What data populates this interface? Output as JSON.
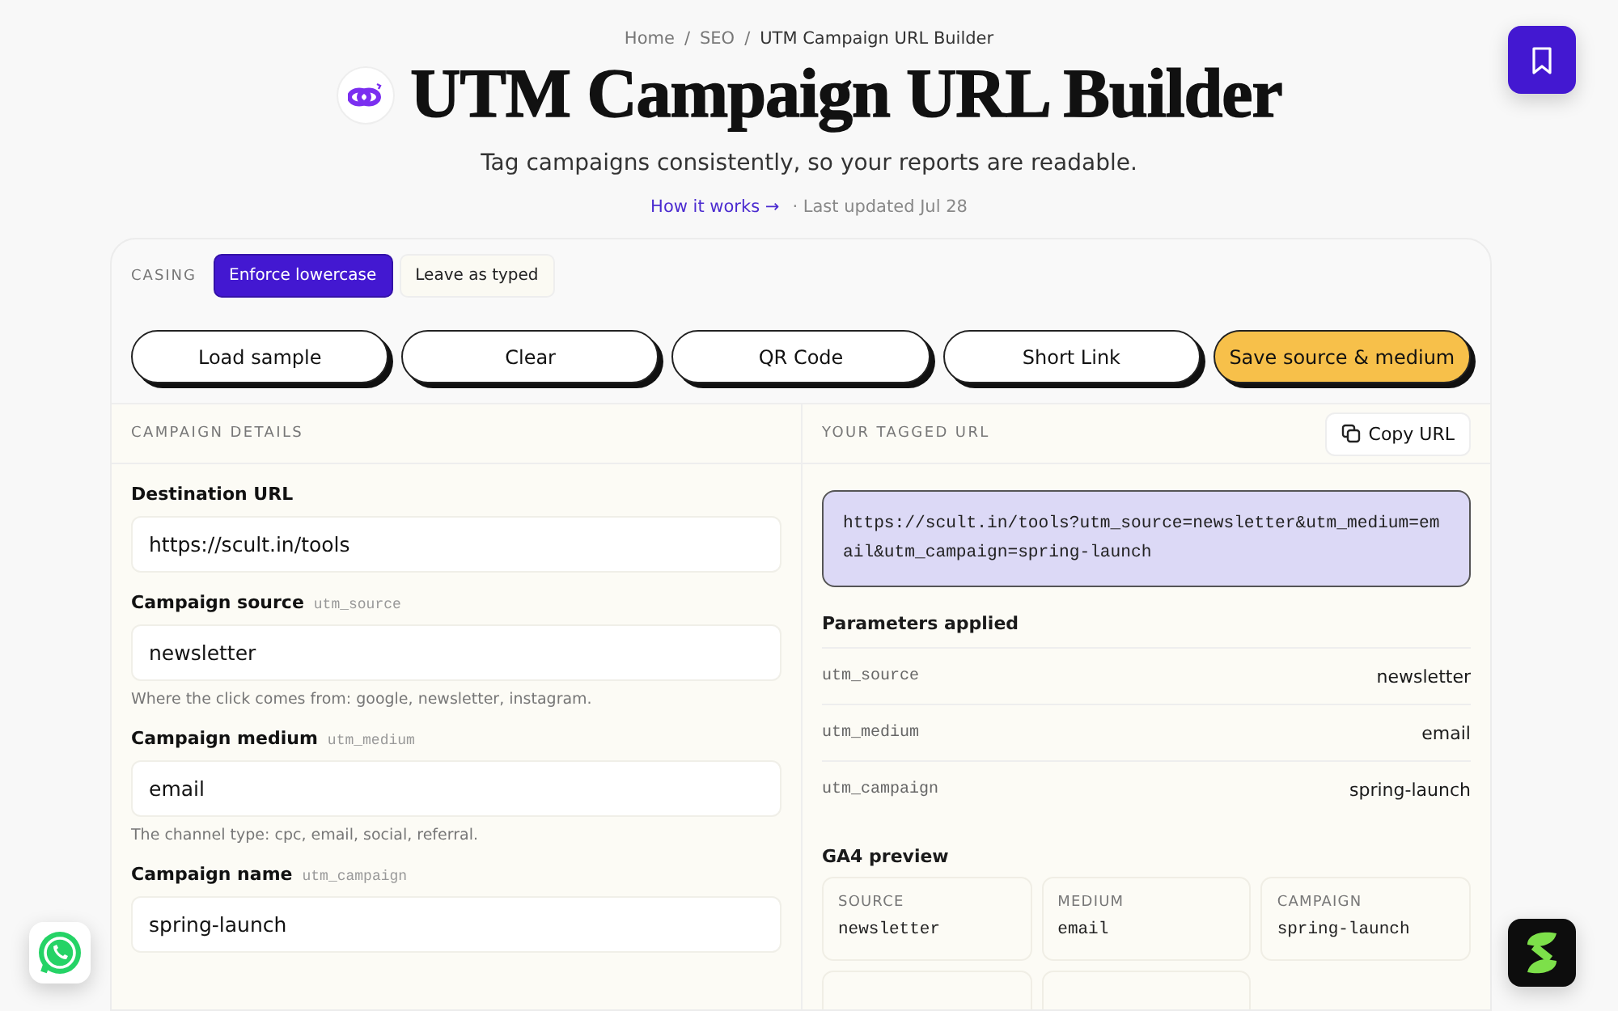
{
  "breadcrumb": {
    "separator": "/",
    "items": [
      {
        "label": "Home"
      },
      {
        "label": "SEO"
      },
      {
        "label": "UTM Campaign URL Builder"
      }
    ]
  },
  "title": "UTM Campaign URL Builder",
  "subtitle": "Tag campaigns consistently, so your reports are readable.",
  "how_link": "How it works →",
  "updated": "· Last updated Jul 28",
  "casing": {
    "label": "CASING",
    "options": [
      {
        "label": "Enforce lowercase",
        "selected": true
      },
      {
        "label": "Leave as typed",
        "selected": false
      }
    ]
  },
  "actions": [
    {
      "label": "Load sample",
      "highlighted": false
    },
    {
      "label": "Clear",
      "highlighted": false
    },
    {
      "label": "QR Code",
      "highlighted": false
    },
    {
      "label": "Short Link",
      "highlighted": false
    },
    {
      "label": "Save source & medium",
      "highlighted": true
    }
  ],
  "details": {
    "heading": "CAMPAIGN DETAILS",
    "fields": [
      {
        "label": "Destination URL",
        "value": "https://scult.in/tools"
      },
      {
        "label": "Campaign source",
        "param": "utm_source",
        "value": "newsletter",
        "help": "Where the click comes from: google, newsletter, instagram."
      },
      {
        "label": "Campaign medium",
        "param": "utm_medium",
        "value": "email",
        "help": "The channel type: cpc, email, social, referral."
      },
      {
        "label": "Campaign name",
        "param": "utm_campaign",
        "value": "spring-launch"
      }
    ]
  },
  "output": {
    "heading": "YOUR TAGGED URL",
    "copy_button": "Copy URL",
    "url": "https://scult.in/tools?utm_source=newsletter&utm_medium=email&utm_campaign=spring-launch",
    "params_heading": "Parameters applied",
    "params": [
      {
        "key": "utm_source",
        "value": "newsletter"
      },
      {
        "key": "utm_medium",
        "value": "email"
      },
      {
        "key": "utm_campaign",
        "value": "spring-launch"
      }
    ],
    "preview_heading": "GA4 preview",
    "preview": [
      {
        "kind": "value",
        "label": "SOURCE",
        "value": "newsletter"
      },
      {
        "kind": "value",
        "label": "MEDIUM",
        "value": "email"
      },
      {
        "kind": "value",
        "label": "CAMPAIGN",
        "value": "spring-launch"
      },
      {
        "kind": "clipped"
      },
      {
        "kind": "clipped"
      }
    ]
  }
}
